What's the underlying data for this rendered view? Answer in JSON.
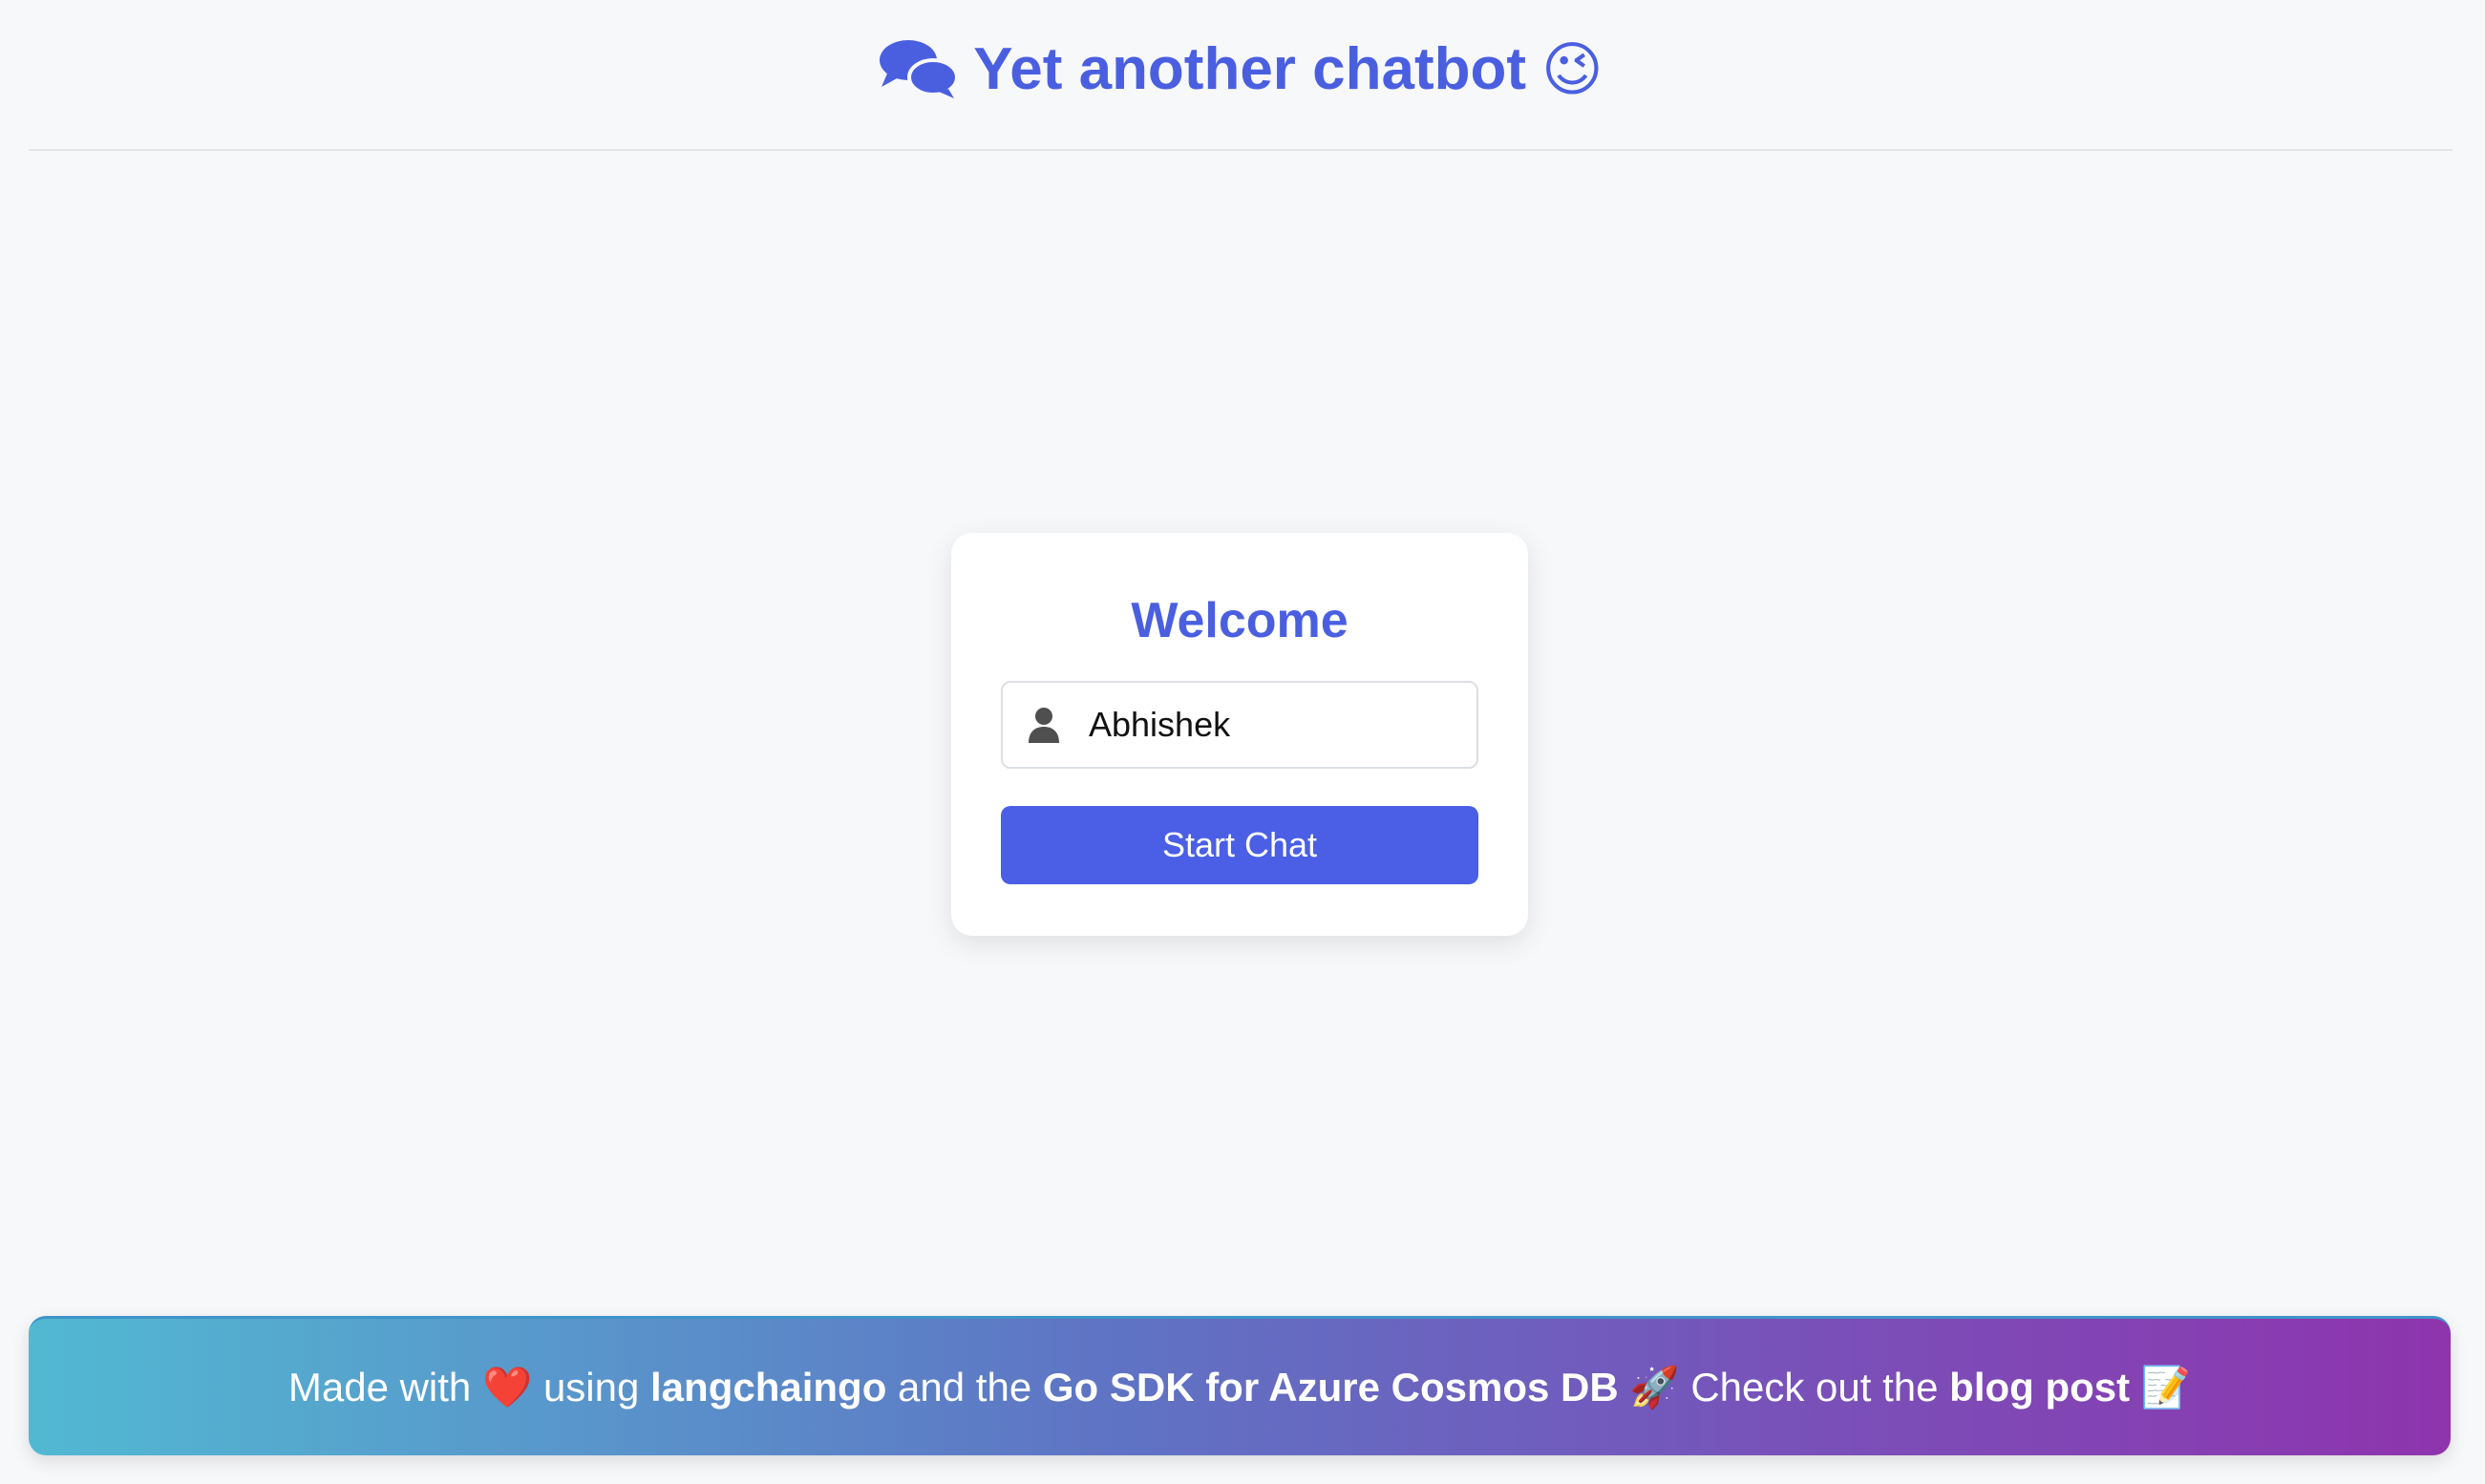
{
  "header": {
    "chat_icon": "speech-bubbles-icon",
    "title": "Yet another chatbot",
    "title_emoji": "😉"
  },
  "login": {
    "heading": "Welcome",
    "user_icon": "user-icon",
    "name_value": "Abhishek",
    "start_button": "Start Chat"
  },
  "footer": {
    "made_with": "Made with",
    "heart": "❤️",
    "using": "using",
    "langchaingo": "langchaingo",
    "and_the": "and the",
    "sdk": "Go SDK for Azure Cosmos DB",
    "rocket": "🚀",
    "check_out": "Check out the",
    "blog_post": "blog post",
    "memo": "📝"
  },
  "colors": {
    "accent": "#4a5fe0",
    "button": "#4a5fe5",
    "background": "#f7f8fa",
    "footer_gradient_start": "#52b9d2",
    "footer_gradient_end": "#8e34ad"
  }
}
